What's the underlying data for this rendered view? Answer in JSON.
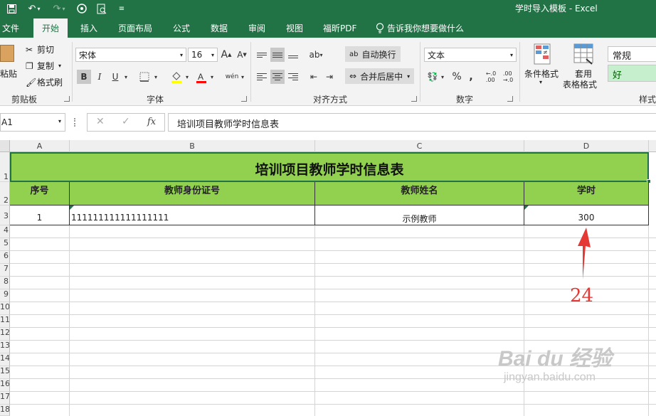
{
  "window": {
    "title": "学时导入模板 - Excel"
  },
  "tabs": [
    "文件",
    "开始",
    "插入",
    "页面布局",
    "公式",
    "数据",
    "审阅",
    "视图",
    "福昕PDF"
  ],
  "active_tab": "开始",
  "tell_me": "告诉我你想要做什么",
  "ribbon": {
    "clipboard": {
      "paste": "粘贴",
      "cut": "剪切",
      "copy": "复制",
      "format_painter": "格式刷",
      "label": "剪贴板"
    },
    "font": {
      "family": "宋体",
      "size": "16",
      "bold": "B",
      "italic": "I",
      "underline": "U",
      "label": "字体"
    },
    "alignment": {
      "wrap_text": "自动换行",
      "merge_center": "合并后居中",
      "label": "对齐方式"
    },
    "number": {
      "format": "文本",
      "percent": "%",
      "comma": ",",
      "label": "数字"
    },
    "styles": {
      "conditional": "条件格式",
      "table_format_1": "套用",
      "table_format_2": "表格格式",
      "normal": "常规",
      "good": "好",
      "label": "样式"
    }
  },
  "formula_bar": {
    "name_box": "A1",
    "fx": "fx",
    "content": "培训项目教师学时信息表"
  },
  "sheet": {
    "columns": [
      "A",
      "B",
      "C",
      "D"
    ],
    "rows": [
      "1",
      "2",
      "3",
      "4",
      "5",
      "6",
      "7",
      "8",
      "9",
      "10",
      "11",
      "12",
      "13",
      "14",
      "15",
      "16",
      "17",
      "18"
    ],
    "title": "培训项目教师学时信息表",
    "headers": [
      "序号",
      "教师身份证号",
      "教师姓名",
      "学时"
    ],
    "data": [
      [
        "1",
        "111111111111111111",
        "示例教师",
        "300"
      ]
    ]
  },
  "annotation": {
    "label": "24",
    "color": "#e53935"
  },
  "watermark": {
    "line1": "Bai du 经验",
    "line2": "jingyan.baidu.com"
  },
  "colors": {
    "excel_green": "#217346",
    "header_fill": "#92d050"
  }
}
